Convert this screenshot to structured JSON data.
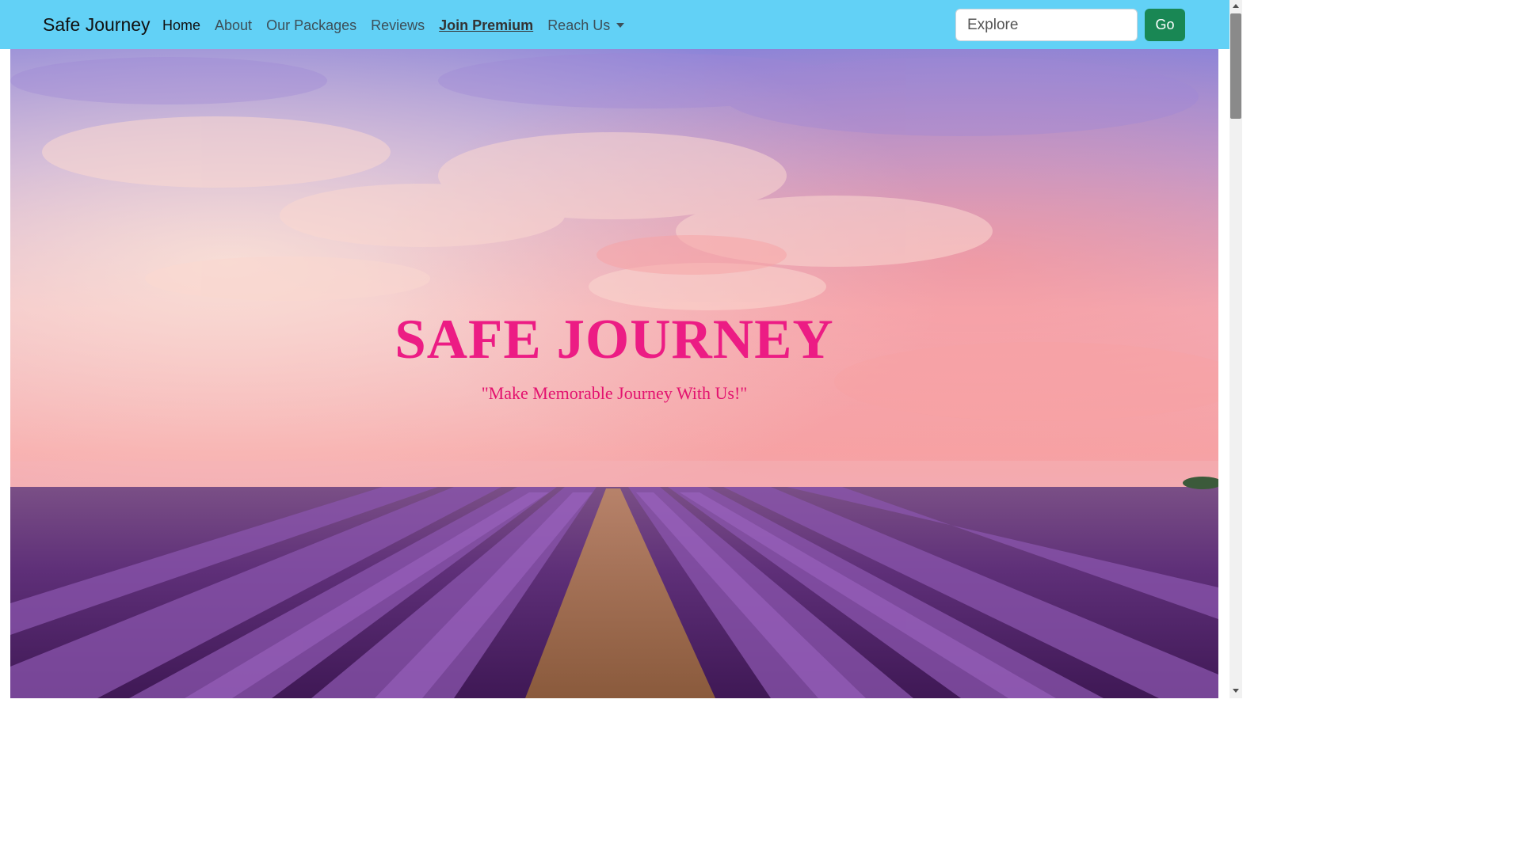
{
  "navbar": {
    "brand": "Safe Journey",
    "links": [
      {
        "label": "Home"
      },
      {
        "label": "About"
      },
      {
        "label": "Our Packages"
      },
      {
        "label": "Reviews"
      },
      {
        "label": "Join Premium"
      },
      {
        "label": "Reach Us"
      }
    ],
    "search": {
      "placeholder": "Explore",
      "value": ""
    },
    "go_label": "Go",
    "background_color": "#62d1f6",
    "go_button_color": "#198754"
  },
  "hero": {
    "title": "SAFE JOURNEY",
    "tagline": "\"Make Memorable Journey With Us!\"",
    "title_color": "#ec1c84",
    "image": "lavender-field-sunset"
  },
  "icons": {
    "dropdown": "caret-down-icon"
  }
}
